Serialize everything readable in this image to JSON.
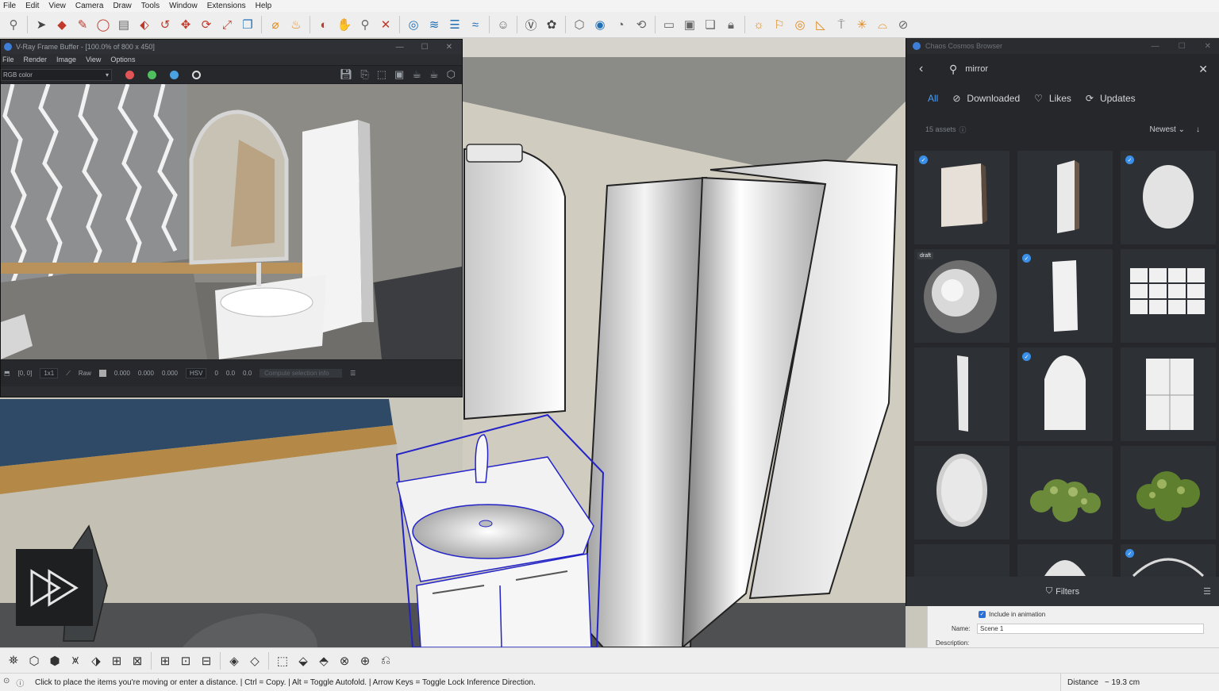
{
  "menubar": {
    "items": [
      "File",
      "Edit",
      "View",
      "Camera",
      "Draw",
      "Tools",
      "Window",
      "Extensions",
      "Help"
    ]
  },
  "toolbar": {
    "icons": [
      "zoom-icon",
      "select-icon",
      "eraser-icon",
      "pencil-icon",
      "lasso-icon",
      "paint-bucket-icon",
      "push-pull-icon",
      "follow-me-icon",
      "move-icon",
      "rotate-icon",
      "scale-icon",
      "offset-icon",
      "tape-measure-icon",
      "paint-icon",
      "orbit-icon",
      "pan-icon",
      "zoom-window-icon",
      "zoom-extents-icon"
    ]
  },
  "vfb": {
    "title": "V-Ray Frame Buffer - [100.0% of 800 x 450]",
    "menu": [
      "File",
      "Render",
      "Image",
      "View",
      "Options"
    ],
    "channel": "RGB color",
    "status": {
      "coords": "[0, 0]",
      "ratio": "1x1",
      "raw_label": "Raw",
      "rgb": [
        "0.000",
        "0.000",
        "0.000"
      ],
      "mode": "HSV",
      "hsv": [
        "0",
        "0.0",
        "0.0"
      ],
      "ghost_button": "Compute selection info"
    }
  },
  "cosmos": {
    "title": "Chaos Cosmos Browser",
    "search_value": "mirror",
    "tabs": [
      {
        "label": "All",
        "active": true
      },
      {
        "label": "Downloaded",
        "active": false
      },
      {
        "label": "Likes",
        "active": false
      },
      {
        "label": "Updates",
        "active": false
      }
    ],
    "asset_count": "15 assets",
    "sort_label": "Newest",
    "draft_badge": "draft",
    "filters_label": "Filters",
    "accent_color": "#4a9ff5",
    "check_color": "#3a8fe8"
  },
  "scene_panel": {
    "include_label": "Include in animation",
    "name_label": "Name:",
    "name_value": "Scene 1",
    "description_label": "Description:"
  },
  "statusbar": {
    "message": "Click to place the items you're moving or enter a distance. | Ctrl = Copy. | Alt = Toggle Autofold. | Arrow Keys = Toggle Lock Inference Direction.",
    "distance_label": "Distance",
    "distance_value": "~ 19.3 cm"
  }
}
